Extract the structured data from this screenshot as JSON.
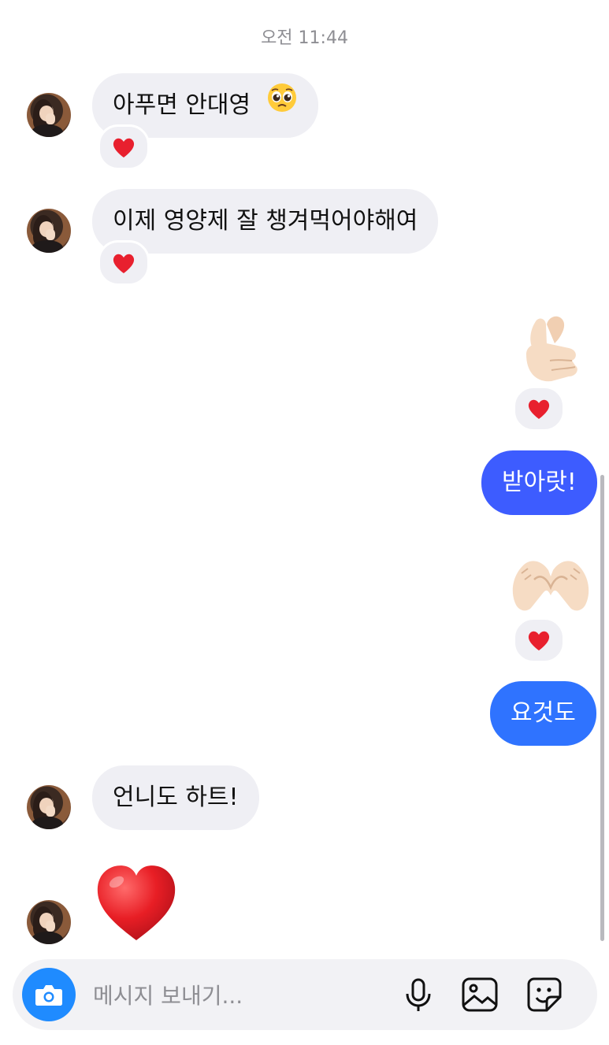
{
  "timestamp": "오전 11:44",
  "messages": [
    {
      "sender": "them",
      "text": "아푸면 안대영",
      "emoji": "pleading-face",
      "reaction": "heart"
    },
    {
      "sender": "them",
      "text": "이제 영양제 잘 챙겨먹어야해여",
      "reaction": "heart"
    },
    {
      "sender": "me",
      "emoji": "finger-heart",
      "reaction": "heart"
    },
    {
      "sender": "me",
      "text": "받아랏!"
    },
    {
      "sender": "me",
      "emoji": "heart-hands",
      "reaction": "heart"
    },
    {
      "sender": "me",
      "text": "요것도"
    },
    {
      "sender": "them",
      "text": "언니도 하트!"
    },
    {
      "sender": "them",
      "emoji": "red-heart"
    }
  ],
  "composer": {
    "placeholder": "메시지 보내기...",
    "icons": [
      "camera-icon",
      "microphone-icon",
      "gallery-icon",
      "sticker-icon"
    ]
  },
  "colors": {
    "incoming_bubble": "#efeff4",
    "outgoing_bubble_1": "#3d5cff",
    "outgoing_bubble_2": "#2f73ff",
    "reaction_heart": "#e8202e",
    "camera_button": "#1f8bff"
  }
}
